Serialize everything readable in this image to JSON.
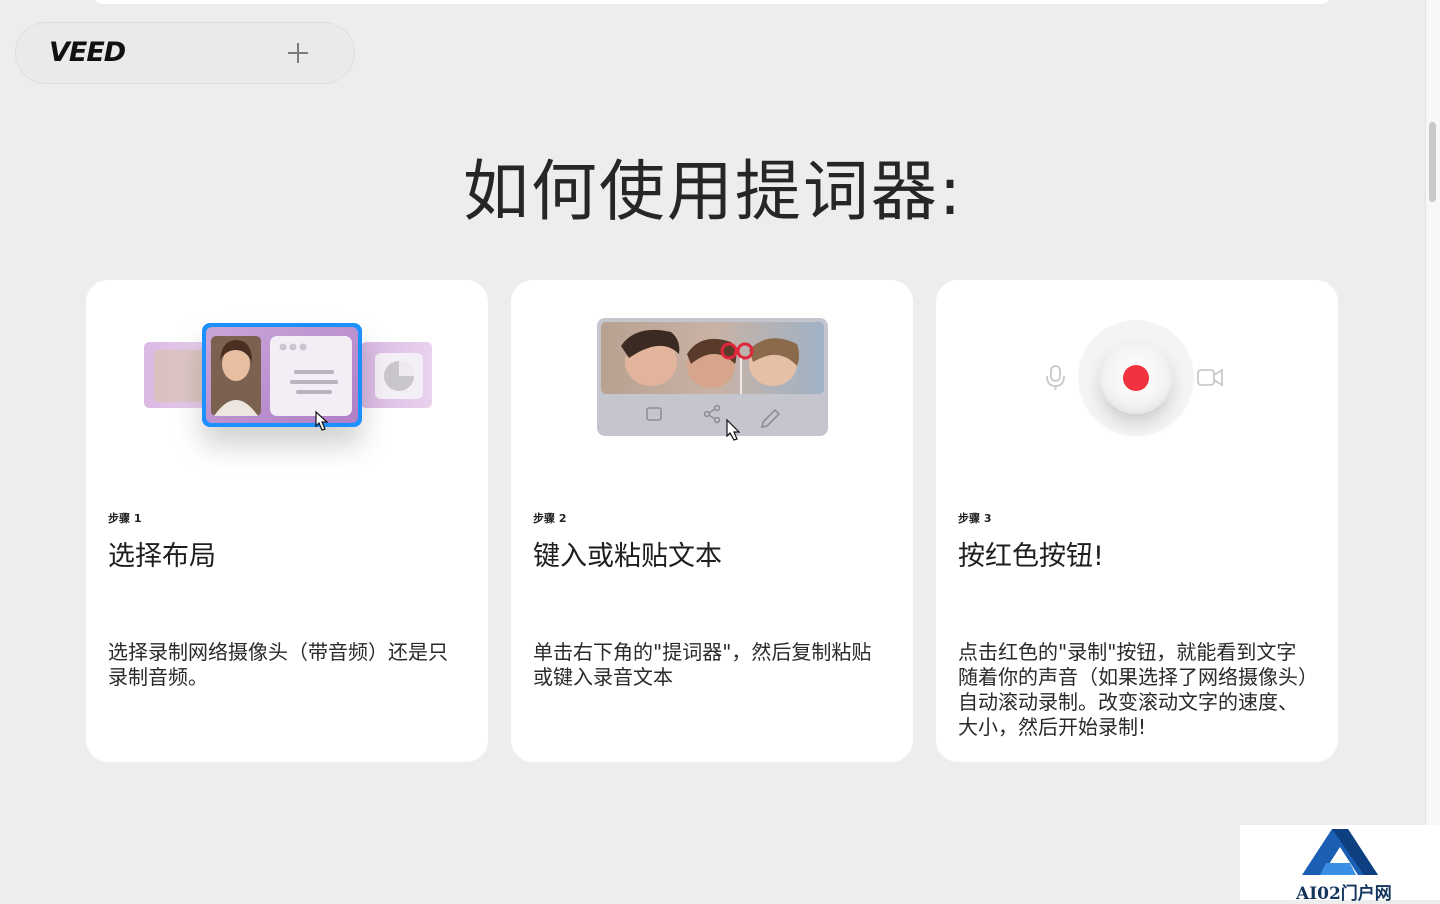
{
  "header": {
    "logo_text": "VEED",
    "new_tab_icon": "plus-icon"
  },
  "main": {
    "title": "如何使用提词器:"
  },
  "steps": [
    {
      "label": "步骤 1",
      "title": "选择布局",
      "description": "选择录制网络摄像头（带音频）还是只录制音频。"
    },
    {
      "label": "步骤 2",
      "title": "键入或粘贴文本",
      "description": "单击右下角的\"提词器\"，然后复制粘贴或键入录音文本"
    },
    {
      "label": "步骤 3",
      "title": "按红色按钮!",
      "description": "点击红色的\"录制\"按钮，就能看到文字随着你的声音（如果选择了网络摄像头）自动滚动录制。改变滚动文字的速度、大小，然后开始录制!"
    }
  ],
  "watermark": {
    "text": "AI02门户网"
  },
  "colors": {
    "page_background": "#ecedec",
    "card_background": "#ffffff",
    "record_red": "#f0333f",
    "selection_blue": "#1e90ff"
  }
}
